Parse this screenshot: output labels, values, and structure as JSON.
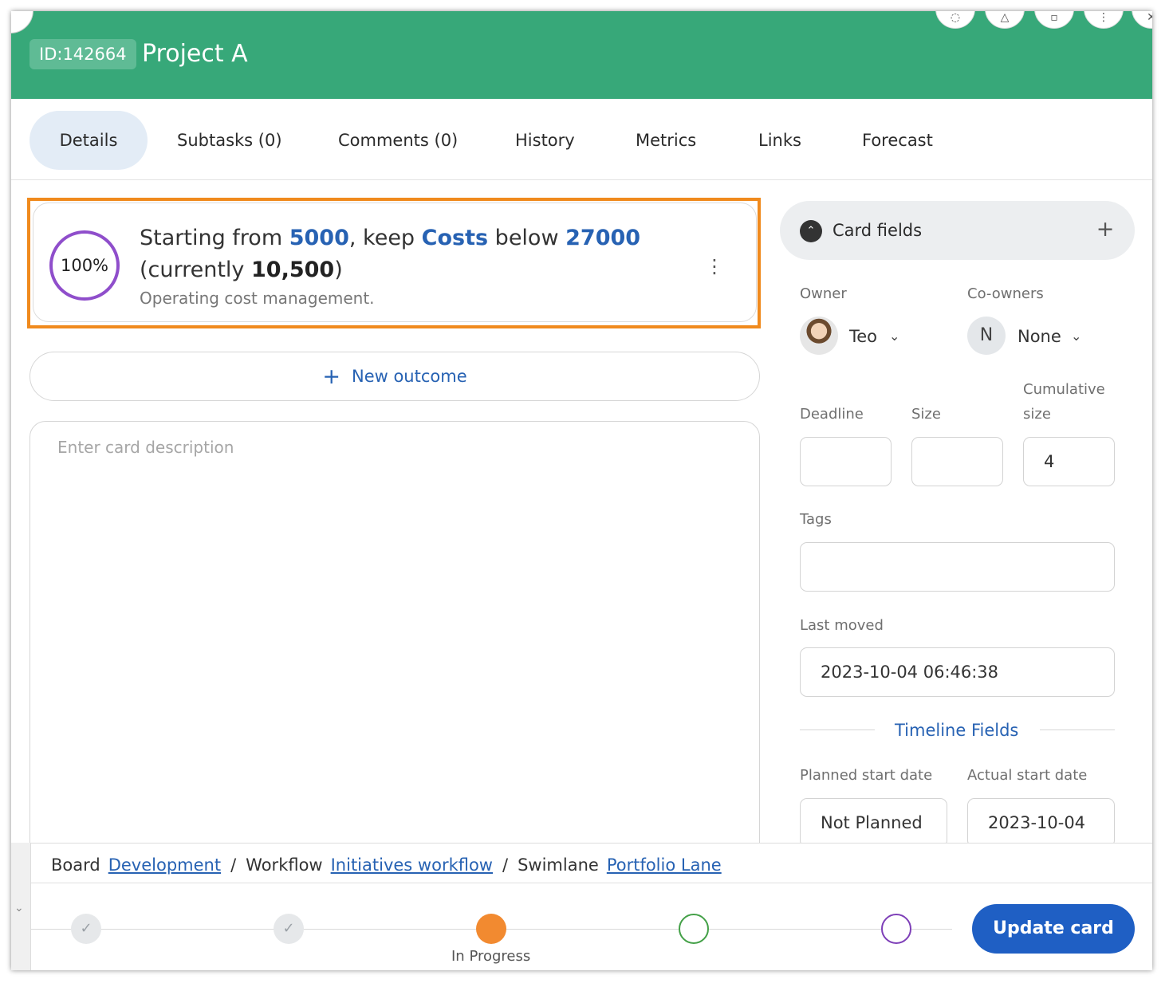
{
  "header": {
    "id_badge": "ID:142664",
    "title": "Project A",
    "color": "#37a879"
  },
  "tabs": [
    {
      "label": "Details",
      "active": true
    },
    {
      "label": "Subtasks (0)"
    },
    {
      "label": "Comments (0)"
    },
    {
      "label": "History"
    },
    {
      "label": "Metrics"
    },
    {
      "label": "Links"
    },
    {
      "label": "Forecast"
    }
  ],
  "outcome": {
    "progress_label": "100%",
    "progress": 1.0,
    "line1_prefix": "Starting from ",
    "start_value": "5000",
    "line1_mid": ", keep ",
    "metric": "Costs",
    "line1_mid2": " below ",
    "target_value": "27000",
    "line2_prefix": "(currently ",
    "current_value": "10,500",
    "line2_suffix": ")",
    "subtitle": "Operating cost management.",
    "menu_icon": "kebab-icon",
    "highlight_color": "#f08a1d"
  },
  "new_outcome": {
    "label": "New outcome"
  },
  "description": {
    "placeholder": "Enter card description",
    "value": ""
  },
  "card_fields": {
    "label": "Card fields",
    "owner": {
      "label": "Owner",
      "name": "Teo"
    },
    "co_owners": {
      "label": "Co-owners",
      "initial": "N",
      "name": "None"
    },
    "deadline": {
      "label": "Deadline",
      "value": ""
    },
    "size": {
      "label": "Size",
      "value": ""
    },
    "cumulative_size": {
      "label_1": "Cumulative",
      "label_2": "size",
      "value": "4"
    },
    "tags": {
      "label": "Tags",
      "value": ""
    },
    "last_moved": {
      "label": "Last moved",
      "value": "2023-10-04 06:46:38"
    },
    "timeline_title": "Timeline Fields",
    "planned_start": {
      "label": "Planned start date",
      "value": "Not Planned"
    },
    "actual_start": {
      "label": "Actual start date",
      "value": "2023-10-04"
    }
  },
  "breadcrumb": {
    "board_label": "Board",
    "board": "Development",
    "workflow_label": "Workflow",
    "workflow": "Initiatives workflow",
    "swimlane_label": "Swimlane",
    "swimlane": "Portfolio Lane",
    "separator": "/"
  },
  "stepper": {
    "current_label": "In Progress",
    "colors": {
      "current": "#f28a30",
      "green": "#43a047",
      "purple": "#7e3fb8"
    }
  },
  "actions": {
    "update": "Update card"
  }
}
